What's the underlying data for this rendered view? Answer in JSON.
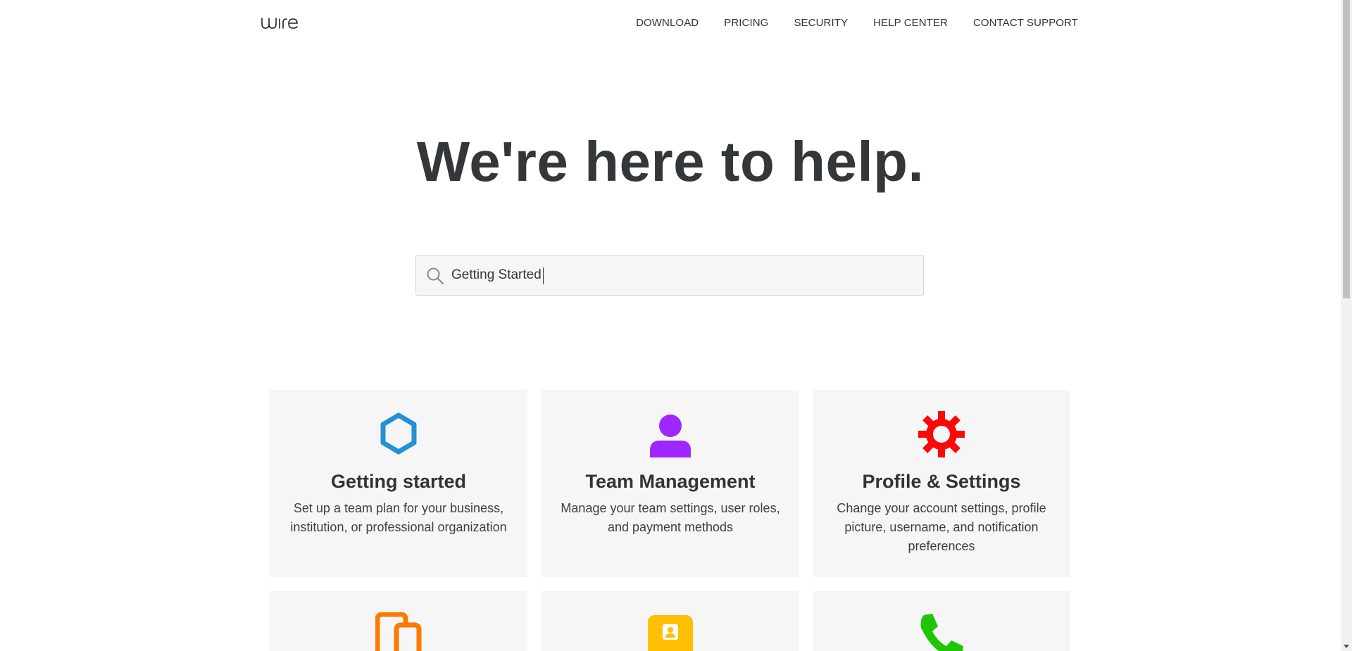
{
  "header": {
    "logo_text": "wire",
    "nav": [
      {
        "label": "DOWNLOAD"
      },
      {
        "label": "PRICING"
      },
      {
        "label": "SECURITY"
      },
      {
        "label": "HELP CENTER"
      },
      {
        "label": "CONTACT SUPPORT"
      }
    ]
  },
  "hero": {
    "title": "We're here to help."
  },
  "search": {
    "value": "Getting Started",
    "icon": "search-icon"
  },
  "cards": [
    {
      "title": "Getting started",
      "description": "Set up a team plan for your business, institution, or professional organization",
      "icon": "hexagon-icon",
      "color": "#2391d3"
    },
    {
      "title": "Team Management",
      "description": "Manage your team settings, user roles, and payment methods",
      "icon": "user-icon",
      "color": "#a026ff"
    },
    {
      "title": "Profile & Settings",
      "description": "Change your account settings, profile picture, username, and notification preferences",
      "icon": "gear-icon",
      "color": "#fb0807"
    },
    {
      "title": "",
      "description": "",
      "icon": "devices-icon",
      "color": "#fd7a00"
    },
    {
      "title": "",
      "description": "",
      "icon": "contact-card-icon",
      "color": "#febf02"
    },
    {
      "title": "",
      "description": "",
      "icon": "phone-icon",
      "color": "#1dc600"
    }
  ]
}
